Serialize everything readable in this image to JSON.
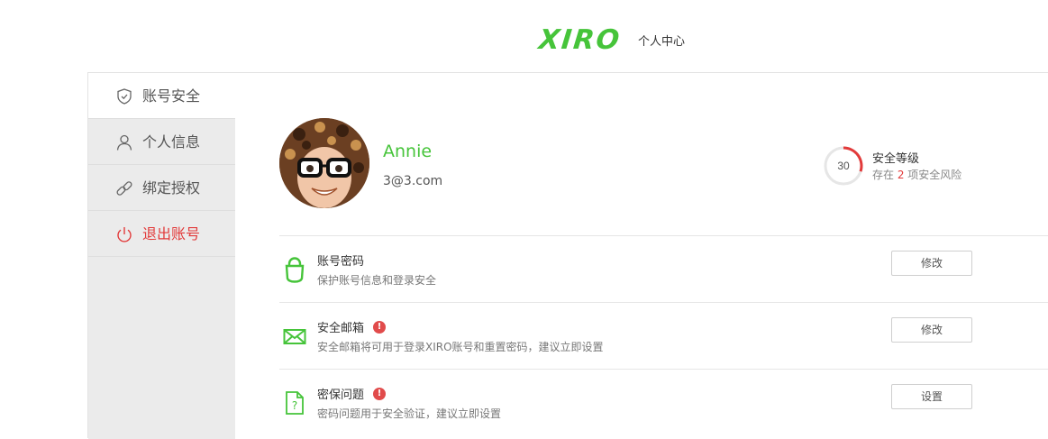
{
  "header": {
    "logo_text": "XIRO",
    "subtitle": "个人中心"
  },
  "sidebar": {
    "items": [
      {
        "label": "账号安全",
        "icon": "shield-icon",
        "active": true
      },
      {
        "label": "个人信息",
        "icon": "user-icon"
      },
      {
        "label": "绑定授权",
        "icon": "link-icon"
      },
      {
        "label": "退出账号",
        "icon": "power-icon",
        "danger": true
      }
    ]
  },
  "profile": {
    "name": "Annie",
    "email": "3@3.com"
  },
  "security": {
    "score": "30",
    "score_fraction": 0.3,
    "title": "安全等级",
    "risk_prefix": "存在 ",
    "risk_count": "2",
    "risk_suffix": " 项安全风险"
  },
  "settings": [
    {
      "title": "账号密码",
      "desc": "保护账号信息和登录安全",
      "button": "修改",
      "icon": "lock-icon",
      "warning": false
    },
    {
      "title": "安全邮箱",
      "desc": "安全邮箱将可用于登录XIRO账号和重置密码，建议立即设置",
      "button": "修改",
      "icon": "mail-icon",
      "warning": true,
      "warning_mark": "!"
    },
    {
      "title": "密保问题",
      "desc": "密码问题用于安全验证，建议立即设置",
      "button": "设置",
      "icon": "question-doc-icon",
      "warning": true,
      "warning_mark": "!"
    }
  ],
  "colors": {
    "brand": "#46c43a",
    "danger": "#e23a3a",
    "gauge_track": "#e6e6e6"
  }
}
